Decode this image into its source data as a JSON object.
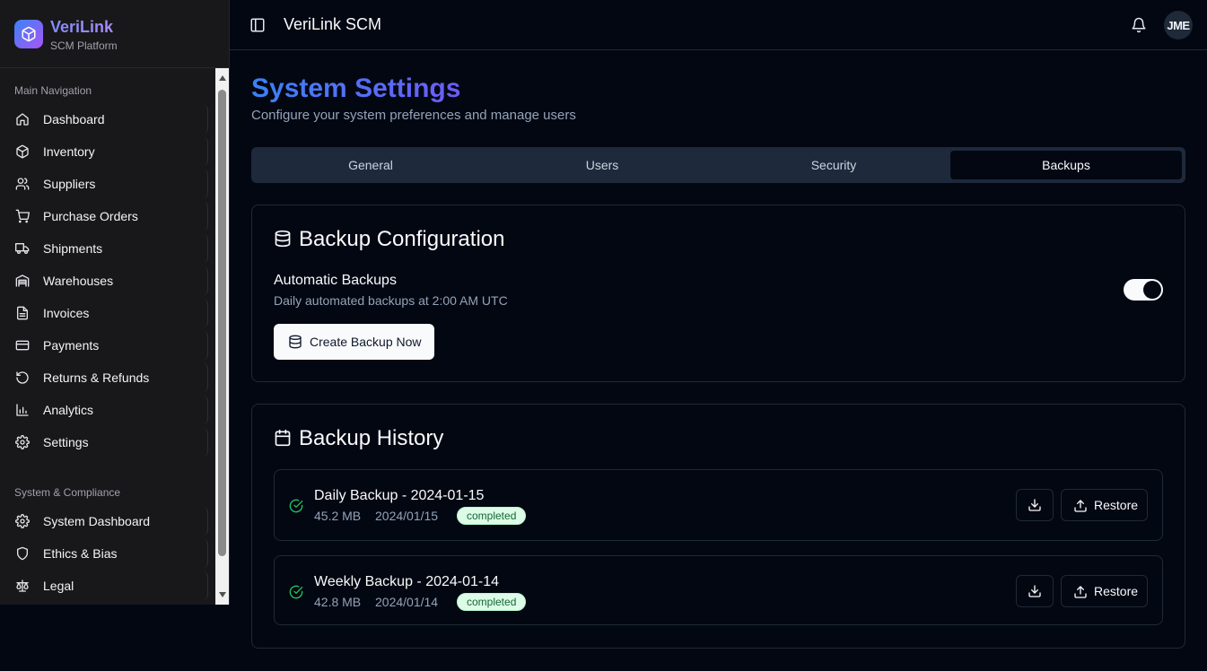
{
  "brand": {
    "name": "VeriLink",
    "subtitle": "SCM Platform"
  },
  "sidebar": {
    "main_label": "Main Navigation",
    "main_items": [
      {
        "label": "Dashboard",
        "icon": "home-icon"
      },
      {
        "label": "Inventory",
        "icon": "package-icon"
      },
      {
        "label": "Suppliers",
        "icon": "users-icon"
      },
      {
        "label": "Purchase Orders",
        "icon": "cart-icon"
      },
      {
        "label": "Shipments",
        "icon": "truck-icon"
      },
      {
        "label": "Warehouses",
        "icon": "warehouse-icon"
      },
      {
        "label": "Invoices",
        "icon": "file-text-icon"
      },
      {
        "label": "Payments",
        "icon": "credit-card-icon"
      },
      {
        "label": "Returns & Refunds",
        "icon": "rotate-ccw-icon"
      },
      {
        "label": "Analytics",
        "icon": "bar-chart-icon"
      },
      {
        "label": "Settings",
        "icon": "gear-icon"
      }
    ],
    "system_label": "System & Compliance",
    "system_items": [
      {
        "label": "System Dashboard",
        "icon": "gear-icon"
      },
      {
        "label": "Ethics & Bias",
        "icon": "shield-icon"
      },
      {
        "label": "Legal",
        "icon": "scale-icon"
      }
    ]
  },
  "header": {
    "title": "VeriLink SCM",
    "avatar_initials": "JME"
  },
  "page": {
    "title": "System Settings",
    "subtitle": "Configure your system preferences and manage users"
  },
  "tabs": [
    {
      "label": "General",
      "active": false
    },
    {
      "label": "Users",
      "active": false
    },
    {
      "label": "Security",
      "active": false
    },
    {
      "label": "Backups",
      "active": true
    }
  ],
  "config": {
    "title": "Backup Configuration",
    "auto_label": "Automatic Backups",
    "auto_desc": "Daily automated backups at 2:00 AM UTC",
    "auto_enabled": true,
    "create_button": "Create Backup Now"
  },
  "history": {
    "title": "Backup History",
    "items": [
      {
        "name": "Daily Backup - 2024-01-15",
        "size": "45.2 MB",
        "date": "2024/01/15",
        "status": "completed",
        "restore_label": "Restore"
      },
      {
        "name": "Weekly Backup - 2024-01-14",
        "size": "42.8 MB",
        "date": "2024/01/14",
        "status": "completed",
        "restore_label": "Restore"
      }
    ]
  },
  "colors": {
    "accent_gradient_start": "#3b82f6",
    "accent_gradient_end": "#6d5cf6",
    "success": "#22c55e",
    "badge_bg": "#dcfce7"
  }
}
